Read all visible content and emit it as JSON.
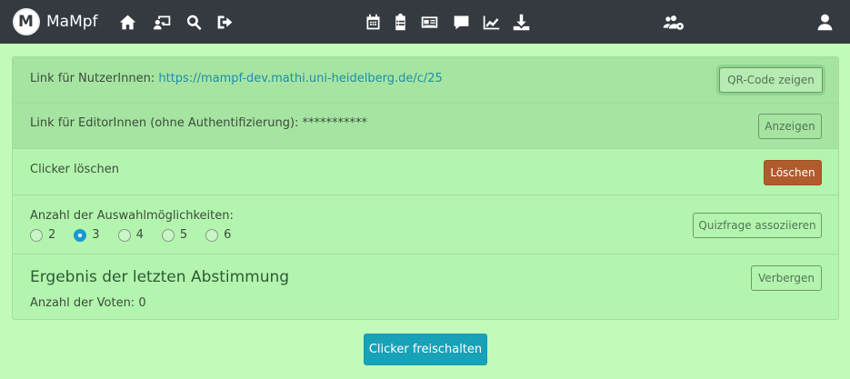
{
  "brand": {
    "name": "MaMpf"
  },
  "nav_icons": [
    "home-icon",
    "lecture-icon",
    "search-icon",
    "logout-icon",
    "calendar-icon",
    "clipboard-icon",
    "newspaper-icon",
    "comment-icon",
    "chart-icon",
    "download-icon",
    "users-cog-icon",
    "user-icon"
  ],
  "rows": {
    "user_link": {
      "label": "Link für NutzerInnen:",
      "url": "https://mampf-dev.mathi.uni-heidelberg.de/c/25",
      "button": "QR-Code zeigen"
    },
    "editor_link": {
      "label": "Link für EditorInnen (ohne Authentifizierung):",
      "value": "***********",
      "button": "Anzeigen"
    },
    "delete": {
      "label": "Clicker löschen",
      "button": "Löschen"
    },
    "alternatives": {
      "label": "Anzahl der Auswahlmöglichkeiten:",
      "options": [
        "2",
        "3",
        "4",
        "5",
        "6"
      ],
      "selected": "3",
      "button": "Quizfrage assoziieren"
    },
    "result": {
      "heading": "Ergebnis der letzten Abstimmung",
      "votes": "Anzahl der Voten: 0",
      "button": "Verbergen"
    }
  },
  "primary_button": "Clicker freischalten",
  "colors": {
    "background": "#c2fbb9",
    "navbar": "#343a40",
    "primary": "#17a2b8",
    "danger": "#b05b2c"
  }
}
